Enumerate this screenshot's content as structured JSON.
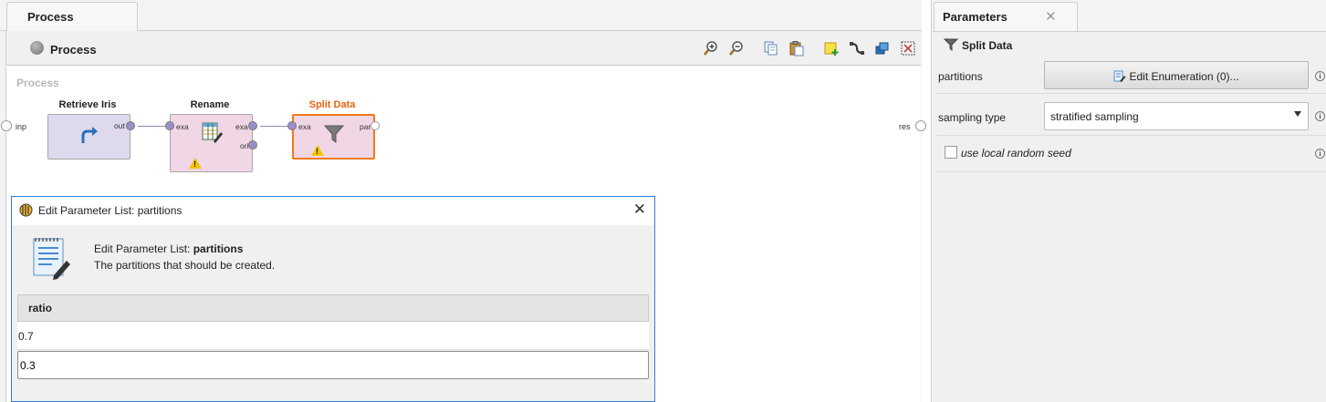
{
  "left_panel": {
    "tab_label": "Process",
    "toolbar_title": "Process",
    "canvas_label": "Process",
    "edge_ports": {
      "input_label": "inp",
      "output_label": "res"
    },
    "operators": [
      {
        "title": "Retrieve Iris",
        "ports_out": [
          "out"
        ],
        "icon": "retrieve-arrow-icon",
        "warning": false
      },
      {
        "title": "Rename",
        "ports_in": [
          "exa"
        ],
        "ports_out": [
          "exa",
          "ori"
        ],
        "icon": "rename-table-icon",
        "warning": true
      },
      {
        "title": "Split Data",
        "ports_in": [
          "exa"
        ],
        "ports_out": [
          "par"
        ],
        "icon": "funnel-icon",
        "warning": true,
        "selected": true
      }
    ]
  },
  "dialog": {
    "window_title": "Edit Parameter List: partitions",
    "header_prefix": "Edit Parameter List: ",
    "header_param": "partitions",
    "description": "The partitions that should be created.",
    "column_header": "ratio",
    "rows": [
      "0.7",
      "0.3"
    ]
  },
  "parameters_panel": {
    "tab_label": "Parameters",
    "operator_name": "Split Data",
    "rows": {
      "partitions": {
        "label": "partitions",
        "button_label": "Edit Enumeration (0)..."
      },
      "sampling_type": {
        "label": "sampling type",
        "selected": "stratified sampling"
      },
      "local_seed": {
        "label": "use local random seed",
        "checked": false
      }
    },
    "info_glyph": "i"
  },
  "colors": {
    "operator_fill": "#ded9ec",
    "operator_fill_alt": "#f1d6e6",
    "selected_border": "#f07a1a",
    "selected_title": "#e8620c",
    "port_fill": "#9c8fc9",
    "dialog_border": "#2f7bd4"
  }
}
